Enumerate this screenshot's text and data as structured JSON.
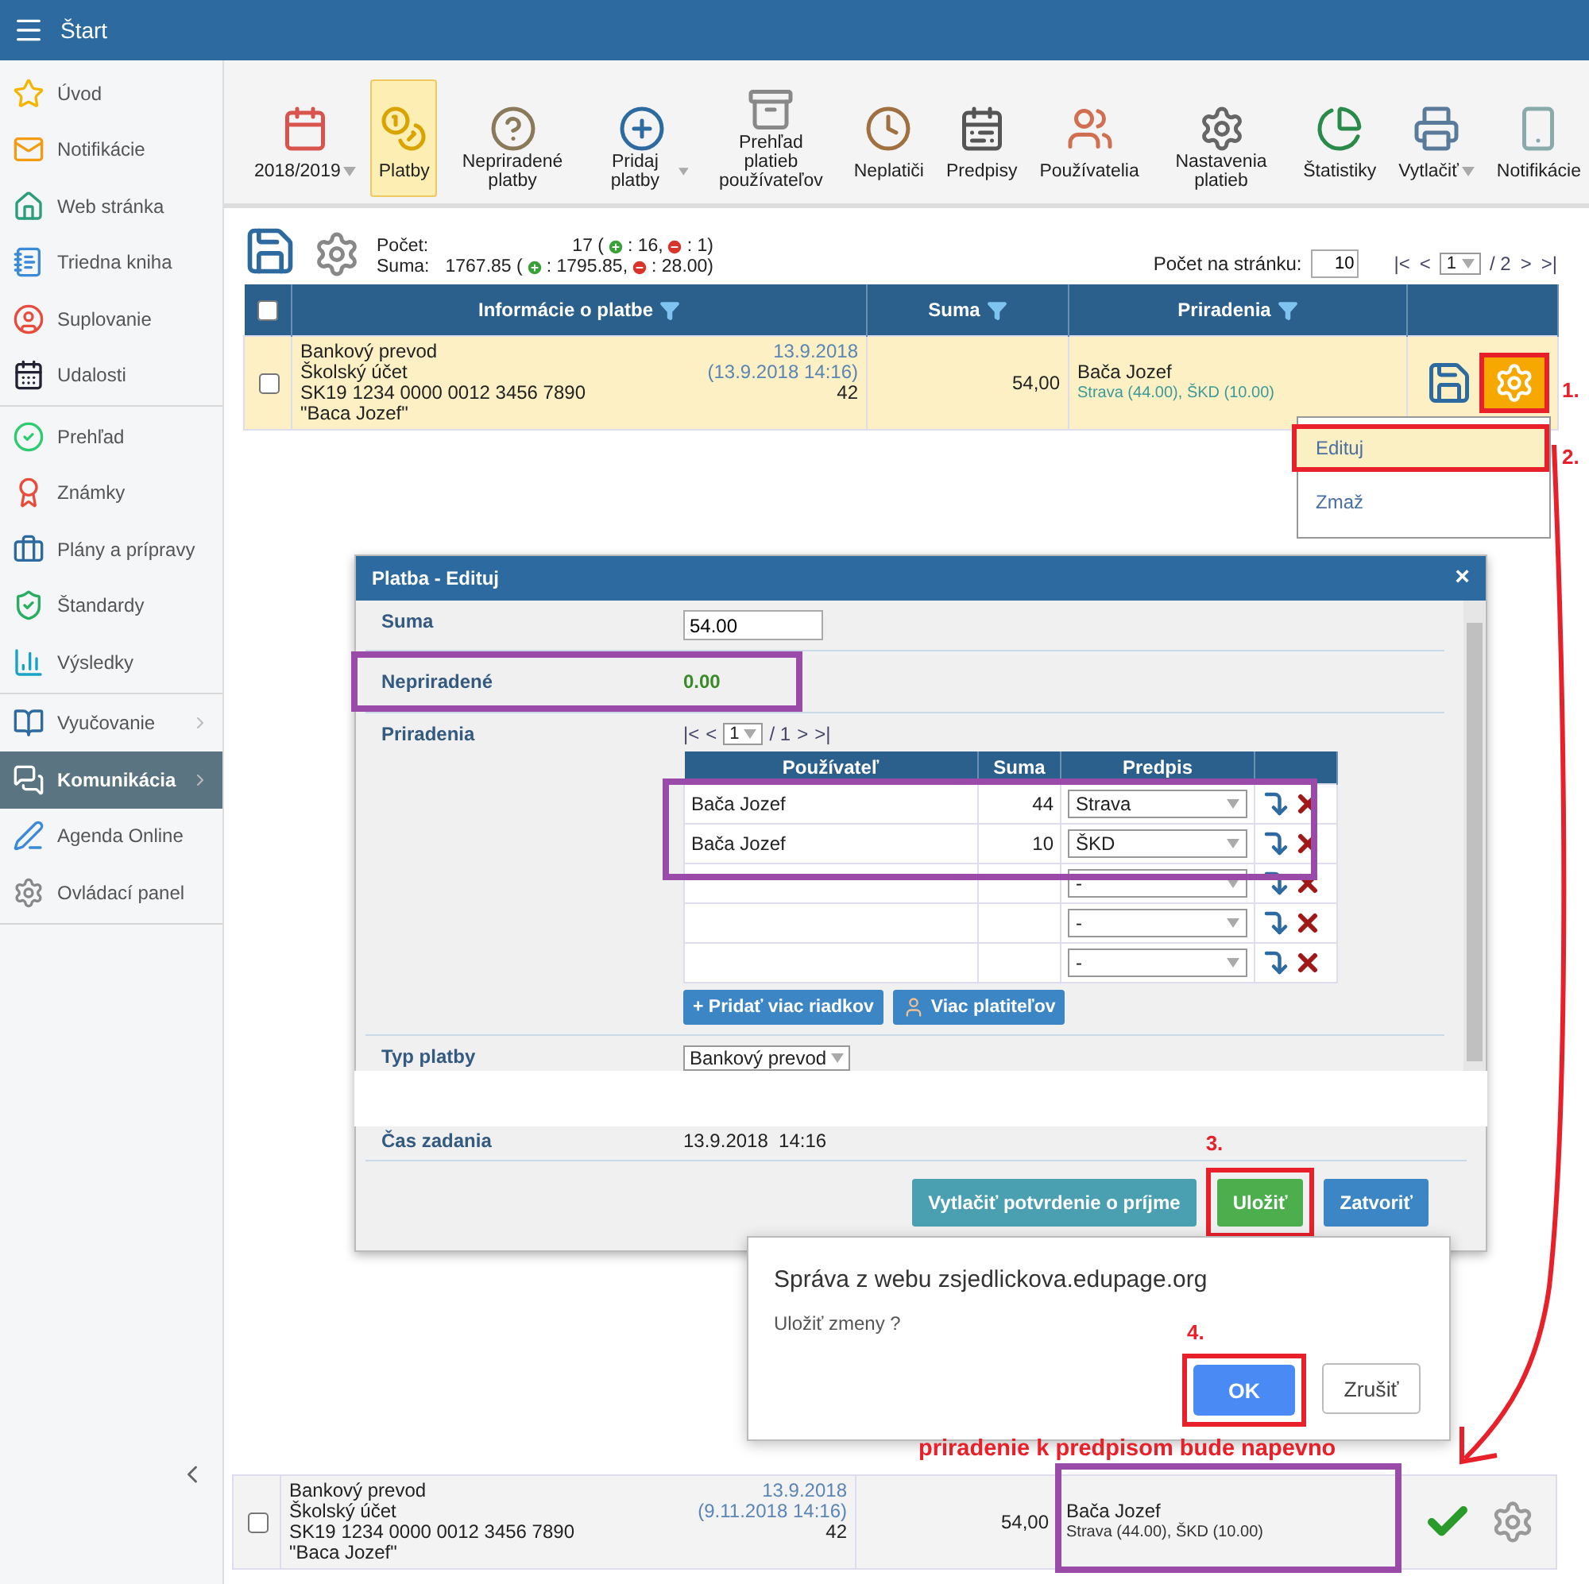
{
  "header": {
    "title": "Štart"
  },
  "sidebar": {
    "groups": [
      {
        "items": [
          {
            "label": "Úvod",
            "selected": false,
            "submenu": false
          },
          {
            "label": "Notifikácie",
            "selected": false,
            "submenu": false
          },
          {
            "label": "Web stránka",
            "selected": false,
            "submenu": false
          },
          {
            "label": "Triedna kniha",
            "selected": false,
            "submenu": false
          },
          {
            "label": "Suplovanie",
            "selected": false,
            "submenu": false
          },
          {
            "label": "Udalosti",
            "selected": false,
            "submenu": false
          }
        ]
      },
      {
        "items": [
          {
            "label": "Prehľad",
            "selected": false,
            "submenu": false
          },
          {
            "label": "Známky",
            "selected": false,
            "submenu": false
          },
          {
            "label": "Plány a prípravy",
            "selected": false,
            "submenu": false
          },
          {
            "label": "Štandardy",
            "selected": false,
            "submenu": false
          },
          {
            "label": "Výsledky",
            "selected": false,
            "submenu": false
          }
        ]
      },
      {
        "items": [
          {
            "label": "Vyučovanie",
            "selected": false,
            "submenu": true
          },
          {
            "label": "Komunikácia",
            "selected": true,
            "submenu": true
          },
          {
            "label": "Agenda Online",
            "selected": false,
            "submenu": false
          },
          {
            "label": "Ovládací panel",
            "selected": false,
            "submenu": false
          }
        ]
      }
    ]
  },
  "toolbar": {
    "items": [
      {
        "label": "2018/2019",
        "selected": false,
        "dropdown": true
      },
      {
        "label": "Platby",
        "selected": true,
        "dropdown": false
      },
      {
        "label": "Nepriradené platby",
        "selected": false,
        "dropdown": false
      },
      {
        "label": "Pridaj platby",
        "selected": false,
        "dropdown": true
      },
      {
        "label": "Prehľad platieb používateľov",
        "selected": false,
        "dropdown": false
      },
      {
        "label": "Neplatiči",
        "selected": false,
        "dropdown": false
      },
      {
        "label": "Predpisy",
        "selected": false,
        "dropdown": false
      },
      {
        "label": "Používatelia",
        "selected": false,
        "dropdown": false
      },
      {
        "label": "Nastavenia platieb",
        "selected": false,
        "dropdown": false
      },
      {
        "label": "Štatistiky",
        "selected": false,
        "dropdown": false
      },
      {
        "label": "Vytlačiť",
        "selected": false,
        "dropdown": true
      },
      {
        "label": "Notifikácie",
        "selected": false,
        "dropdown": false
      }
    ]
  },
  "summary": {
    "lines": [
      {
        "label": "Počet:",
        "total": "17 (",
        "plus": ": 16,",
        "minus": ": 1)"
      },
      {
        "label": "Suma:",
        "total": "1767.85 (",
        "plus": ": 1795.85,",
        "minus": ": 28.00)"
      }
    ],
    "per_page_label": "Počet na stránku:",
    "per_page": "10",
    "pager": {
      "first": "|<",
      "prev": "<",
      "page": "1",
      "of": "/ 2",
      "next": ">",
      "last": ">|"
    }
  },
  "table": {
    "all_checked": false,
    "columns": [
      {
        "label": "Informácie o platbe",
        "filter": true
      },
      {
        "label": "Suma",
        "filter": true
      },
      {
        "label": "Priradenia",
        "filter": true
      }
    ],
    "rows": [
      {
        "checked": false,
        "highlighted": true,
        "kind": "pending",
        "type": "Bankový prevod",
        "date": "13.9.2018",
        "account": "Školský účet",
        "datetime": "(13.9.2018 14:16)",
        "iban": "SK19 1234 0000 0012 3456 7890",
        "number": "42",
        "name": "\"Baca Jozef\"",
        "amount": "54,00",
        "person": "Bača Jozef",
        "assignments": [
          "Strava (44.00)",
          ", ",
          "ŠKD (10.00)"
        ],
        "linked": true
      }
    ]
  },
  "row_menu": {
    "items": [
      {
        "label": "Edituj",
        "selected": true
      },
      {
        "label": "Zmaž",
        "selected": false
      }
    ]
  },
  "dialog": {
    "title": "Platba - Edituj",
    "close": "×",
    "sum_label": "Suma",
    "sum_value": "54.00",
    "unassigned_label": "Nepriradené",
    "unassigned_value": "0.00",
    "assignments_label": "Priradenia",
    "pager": {
      "first": "|<",
      "prev": "<",
      "page": "1",
      "of": "/ 1",
      "next": ">",
      "last": ">|"
    },
    "columns": [
      "Používateľ",
      "Suma",
      "Predpis"
    ],
    "rows": [
      {
        "user": "Bača Jozef",
        "amount": "44",
        "rule": "Strava"
      },
      {
        "user": "Bača Jozef",
        "amount": "10",
        "rule": "ŠKD"
      },
      {
        "rule": "-"
      },
      {
        "rule": "-"
      },
      {
        "rule": "-"
      }
    ],
    "add_rows": "+ Pridať viac riadkov",
    "more_payers": "Viac platiteľov",
    "type_label": "Typ platby",
    "type_value": "Bankový prevod",
    "time_label": "Čas zadania",
    "time_value": "13.9.2018  14:16",
    "buttons": [
      {
        "label": "Vytlačiť potvrdenie o príjme",
        "kind": "print"
      },
      {
        "label": "Uložiť",
        "kind": "save"
      },
      {
        "label": "Zatvoriť",
        "kind": "close"
      }
    ]
  },
  "confirm": {
    "title": "Správa z webu zsjedlickova.edupage.org",
    "message": "Uložiť zmeny ?",
    "ok": "OK",
    "cancel": "Zrušiť"
  },
  "annotations": {
    "step_1": "1.",
    "step_2": "2.",
    "step_3": "3.",
    "step_4": "4.",
    "note": "priradenie k predpisom bude napevno"
  },
  "result_row": {
    "checked": false,
    "highlighted": false,
    "kind": "fixed",
    "type": "Bankový prevod",
    "date": "13.9.2018",
    "account": "Školský účet",
    "datetime": "(9.11.2018 14:16)",
    "iban": "SK19 1234 0000 0012 3456 7890",
    "number": "42",
    "name": "\"Baca Jozef\"",
    "amount": "54,00",
    "person": "Bača Jozef",
    "assignments": [
      "Strava (44.00)",
      ", ",
      "ŠKD (10.00)"
    ],
    "linked": false
  }
}
